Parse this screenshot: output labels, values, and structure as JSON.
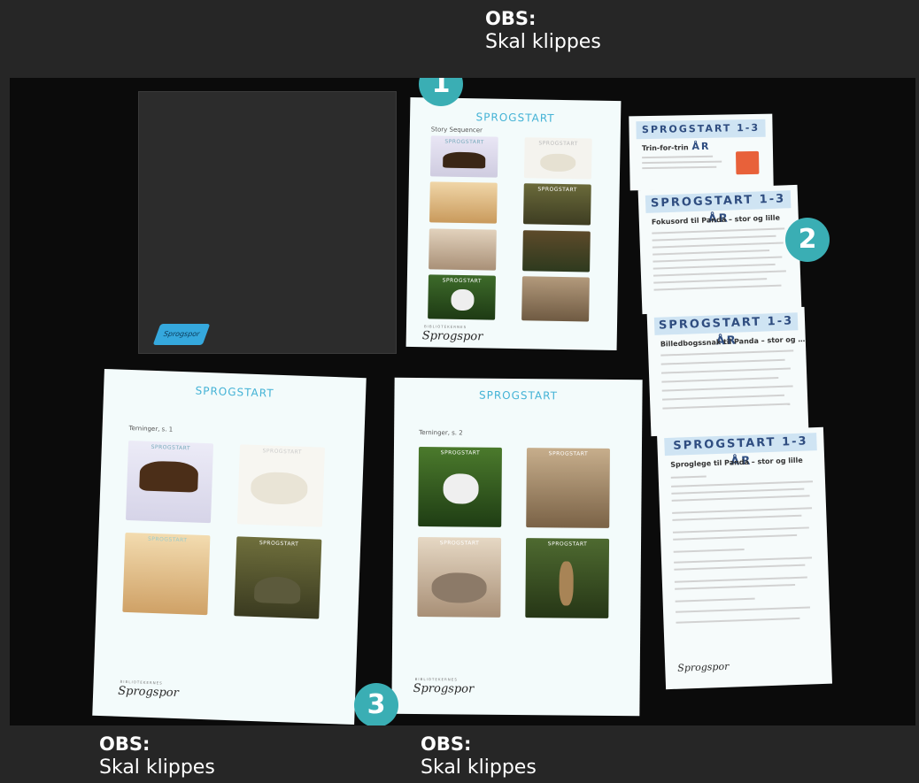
{
  "notes": [
    {
      "title": "OBS:",
      "subtitle": "Skal klippes"
    },
    {
      "title": "OBS:",
      "subtitle": "Skal klippes"
    },
    {
      "title": "OBS:",
      "subtitle": "Skal klippes"
    }
  ],
  "badges": [
    "1",
    "2",
    "3"
  ],
  "top_sheet": {
    "header": "SPROGSTART",
    "subtitle": "Story Sequencer",
    "brand_small": "BIBLIOTEKERNES",
    "brand": "Sprogspor"
  },
  "left_sheet": {
    "header": "SPROGSTART",
    "subtitle": "Terninger, s. 1",
    "brand_small": "BIBLIOTEKERNES",
    "brand": "Sprogspor"
  },
  "right_sheet": {
    "header": "SPROGSTART",
    "subtitle": "Terninger, s. 2",
    "brand_small": "BIBLIOTEKERNES",
    "brand": "Sprogspor"
  },
  "tile_label": "SPROGSTART",
  "folder_logo": "Sprogspor",
  "cards": [
    {
      "band": "SPROGSTART 1-3 ÅR",
      "title": "Trin-for-trin"
    },
    {
      "band": "SPROGSTART 1-3 ÅR",
      "title": "Fokusord til Panda – stor og lille"
    },
    {
      "band": "SPROGSTART 1-3 ÅR",
      "title": "Billedbogssnak til Panda – stor og …"
    },
    {
      "band": "SPROGSTART 1-3 ÅR",
      "title": "Sproglege til Panda – stor og lille",
      "brand": "Sprogspor"
    }
  ],
  "colors": {
    "badge": "#3aaeb4",
    "header_blue": "#45b3d6",
    "band": "#cfe4f3",
    "background": "#262626"
  }
}
